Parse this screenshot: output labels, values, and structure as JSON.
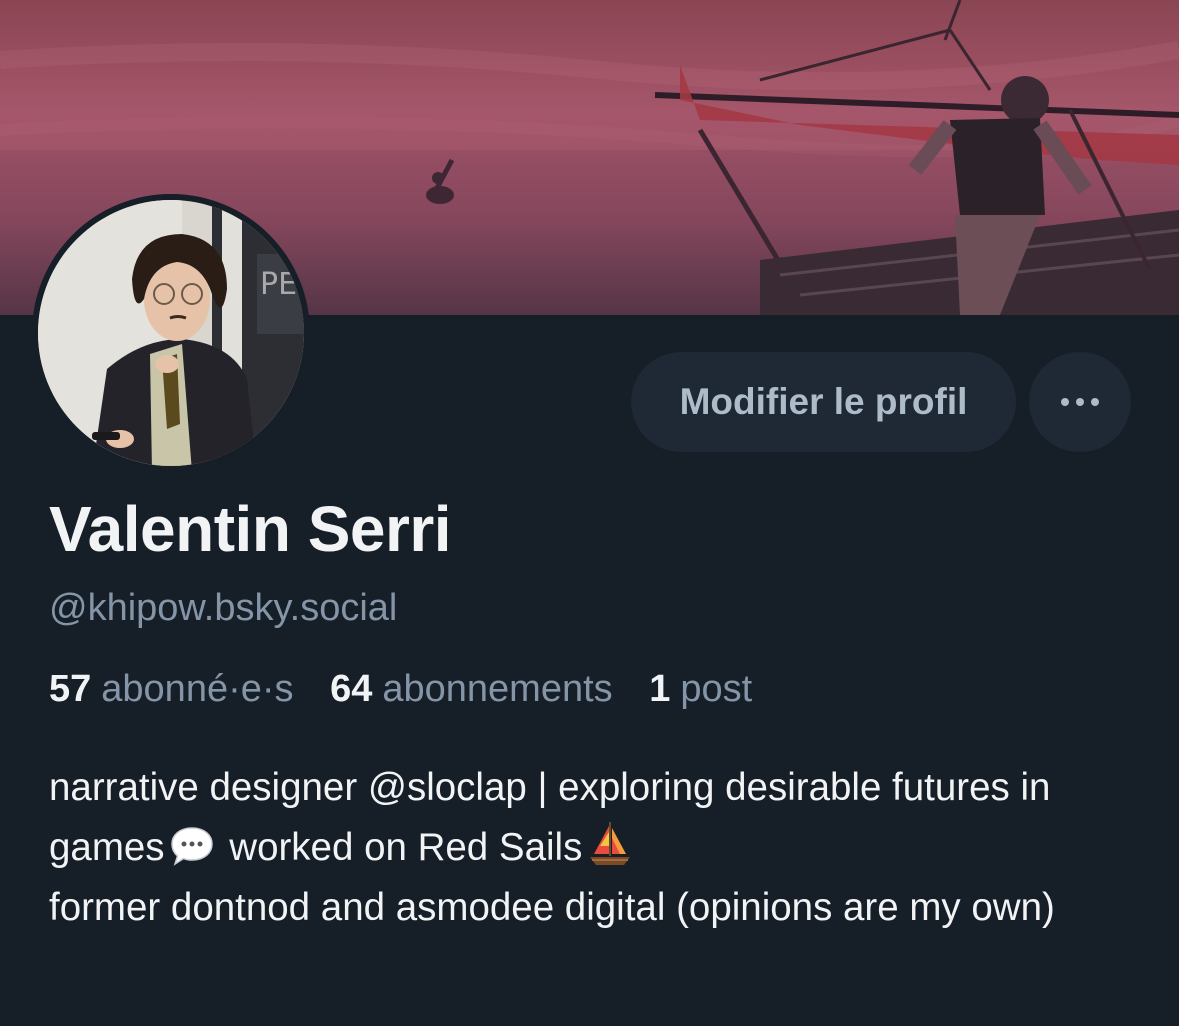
{
  "profile": {
    "display_name": "Valentin Serri",
    "handle": "@khipow.bsky.social"
  },
  "actions": {
    "edit_label": "Modifier le profil",
    "more_icon": "ellipsis-icon"
  },
  "stats": {
    "followers_count": "57",
    "followers_label": "abonné·e·s",
    "following_count": "64",
    "following_label": "abonnements",
    "posts_count": "1",
    "posts_label": "post"
  },
  "bio": {
    "part1": "narrative designer @sloclap | exploring desirable futures in games",
    "part2": "worked on Red Sails",
    "part3": "former dontnod and asmodee digital (opinions are my own)",
    "emoji1": "speech-bubble-icon",
    "emoji2": "sailboat-icon"
  },
  "colors": {
    "background": "#161e27",
    "button_bg": "#1e2935",
    "text_primary": "#f1f3f5",
    "text_secondary": "#8495a7"
  }
}
